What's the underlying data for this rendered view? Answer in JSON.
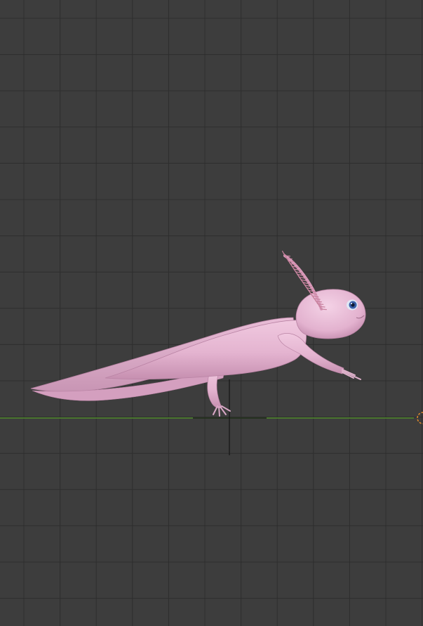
{
  "viewport": {
    "editor": "3D Viewport",
    "view": "side",
    "grid_visible": true,
    "colors": {
      "background": "#3d3d3d",
      "grid_line": "#2e2e2e",
      "x_axis": "#4f8a2c",
      "cursor": "#1a1a1a",
      "origin_ring": "#e08a2a"
    },
    "model": {
      "subject": "axolotl",
      "colors": {
        "body": "#e4b4d0",
        "body_shadow": "#c994b4",
        "fin": "#d7a2c2",
        "gills": "#c9839f",
        "eye": "#3a5fa8"
      }
    }
  }
}
